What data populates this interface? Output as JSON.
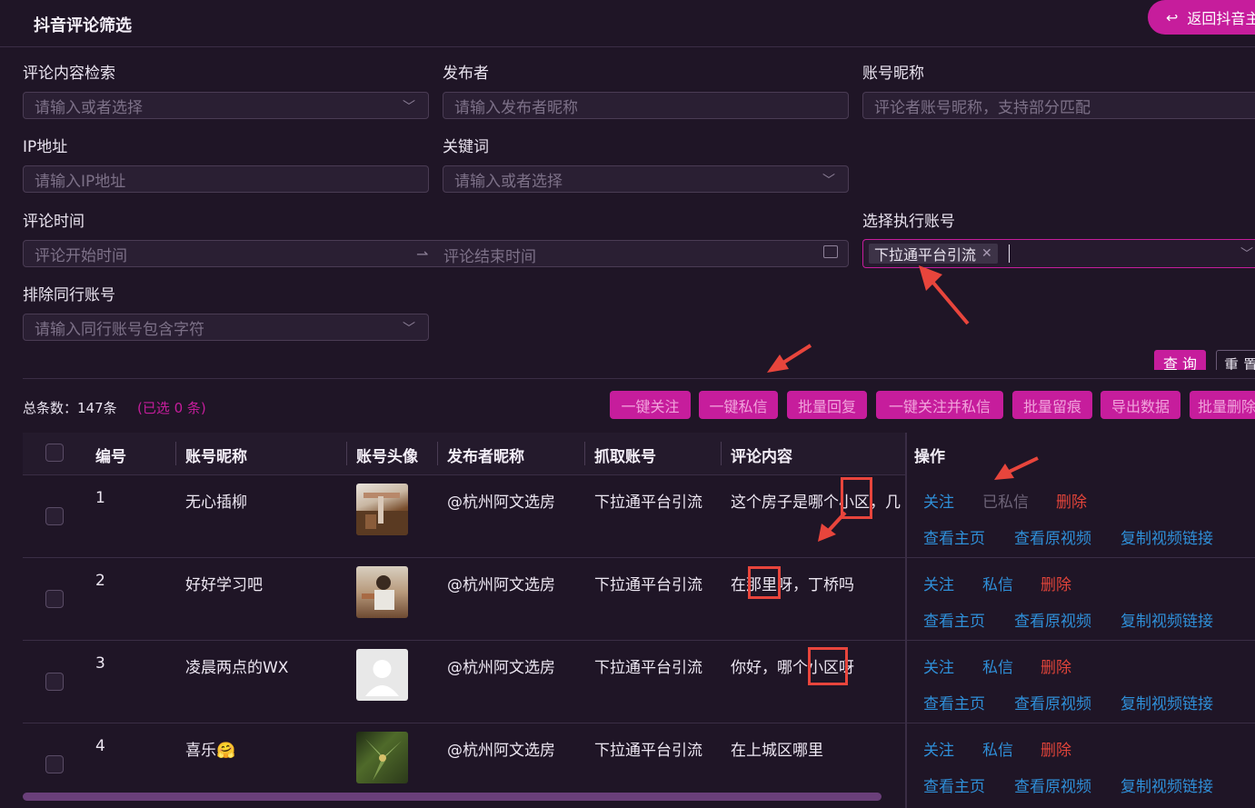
{
  "header": {
    "title": "抖音评论筛选",
    "back_label": "返回抖音主"
  },
  "filters": {
    "comment_search": {
      "label": "评论内容检索",
      "placeholder": "请输入或者选择"
    },
    "publisher": {
      "label": "发布者",
      "placeholder": "请输入发布者昵称"
    },
    "nickname": {
      "label": "账号昵称",
      "placeholder": "评论者账号昵称，支持部分匹配"
    },
    "ip": {
      "label": "IP地址",
      "placeholder": "请输入IP地址"
    },
    "keyword": {
      "label": "关键词",
      "placeholder": "请输入或者选择"
    },
    "time": {
      "label": "评论时间",
      "start_placeholder": "评论开始时间",
      "end_placeholder": "评论结束时间"
    },
    "exec_account": {
      "label": "选择执行账号",
      "selected_tag": "下拉通平台引流"
    },
    "exclude": {
      "label": "排除同行账号",
      "placeholder": "请输入同行账号包含字符"
    }
  },
  "actions": {
    "query": "查 询",
    "reset": "重 置"
  },
  "summary": {
    "total": "总条数：147条",
    "selected": "(已选 0 条)"
  },
  "bulk_buttons": [
    "一键关注",
    "一键私信",
    "批量回复",
    "一键关注并私信",
    "批量留痕",
    "导出数据",
    "批量删除"
  ],
  "table": {
    "headers": [
      "编号",
      "账号昵称",
      "账号头像",
      "发布者昵称",
      "抓取账号",
      "评论内容",
      "操作"
    ],
    "rows": [
      {
        "id": "1",
        "nickname": "无心插柳",
        "publisher": "@杭州阿文选房",
        "account": "下拉通平台引流",
        "comment": "这个房子是哪个小区，几",
        "ops": [
          "关注",
          "已私信",
          "删除",
          "查看主页",
          "查看原视频",
          "复制视频链接"
        ]
      },
      {
        "id": "2",
        "nickname": "好好学习吧",
        "publisher": "@杭州阿文选房",
        "account": "下拉通平台引流",
        "comment": "在那里呀，丁桥吗",
        "ops": [
          "关注",
          "私信",
          "删除",
          "查看主页",
          "查看原视频",
          "复制视频链接"
        ]
      },
      {
        "id": "3",
        "nickname": "凌晨两点的WX",
        "publisher": "@杭州阿文选房",
        "account": "下拉通平台引流",
        "comment": "你好，哪个小区呀",
        "ops": [
          "关注",
          "私信",
          "删除",
          "查看主页",
          "查看原视频",
          "复制视频链接"
        ]
      },
      {
        "id": "4",
        "nickname": "喜乐🤗",
        "publisher": "@杭州阿文选房",
        "account": "下拉通平台引流",
        "comment": "在上城区哪里",
        "ops": [
          "关注",
          "私信",
          "删除",
          "查看主页",
          "查看原视频",
          "复制视频链接"
        ]
      }
    ]
  },
  "colors": {
    "accent": "#c61d9c",
    "link": "#2f8fd8",
    "danger": "#e0443a",
    "annotation": "#e8453c"
  }
}
